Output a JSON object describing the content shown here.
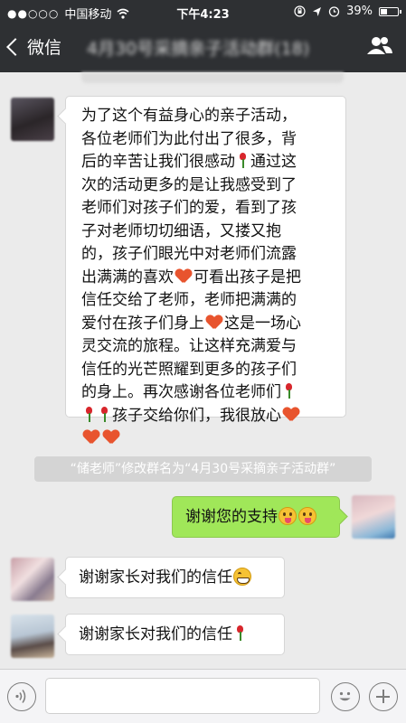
{
  "status_bar": {
    "signal": "●●○○○",
    "carrier": "中国移动",
    "time": "下午4:23",
    "battery": "39%",
    "battery_level": 0.39
  },
  "nav": {
    "back_label": "微信",
    "title": "4月30号采摘亲子活动群(18)"
  },
  "messages": [
    {
      "from": "other",
      "lines": [
        "为了这个有益身心的亲子活动，",
        "各位老师们为此付出了很多，背",
        "后的辛苦让我们很感动",
        "次的活动更多的是让我感受到了",
        "老师们对孩子们的爱，看到了孩",
        "子对老师切切细语，又搂又抱",
        "的，孩子们眼光中对老师们流露",
        "出满满的喜欢",
        "信任交给了老师，老师把满满的",
        "爱付在孩子们身上",
        "灵交流的旅程。让这样充满爱与",
        "信任的光芒照耀到更多的孩子们",
        "的身上。再次感谢各位老师们",
        "孩子交给你们，我很放心"
      ],
      "extras": [
        "通过这",
        "可看出孩子是把",
        "这是一场心"
      ]
    },
    {
      "from": "system",
      "text": "“储老师”修改群名为“4月30号采摘亲子活动群”"
    },
    {
      "from": "me",
      "text": "谢谢您的支持"
    },
    {
      "from": "other",
      "text": "谢谢家长对我们的信任"
    },
    {
      "from": "other",
      "text": "谢谢家长对我们的信任"
    }
  ]
}
